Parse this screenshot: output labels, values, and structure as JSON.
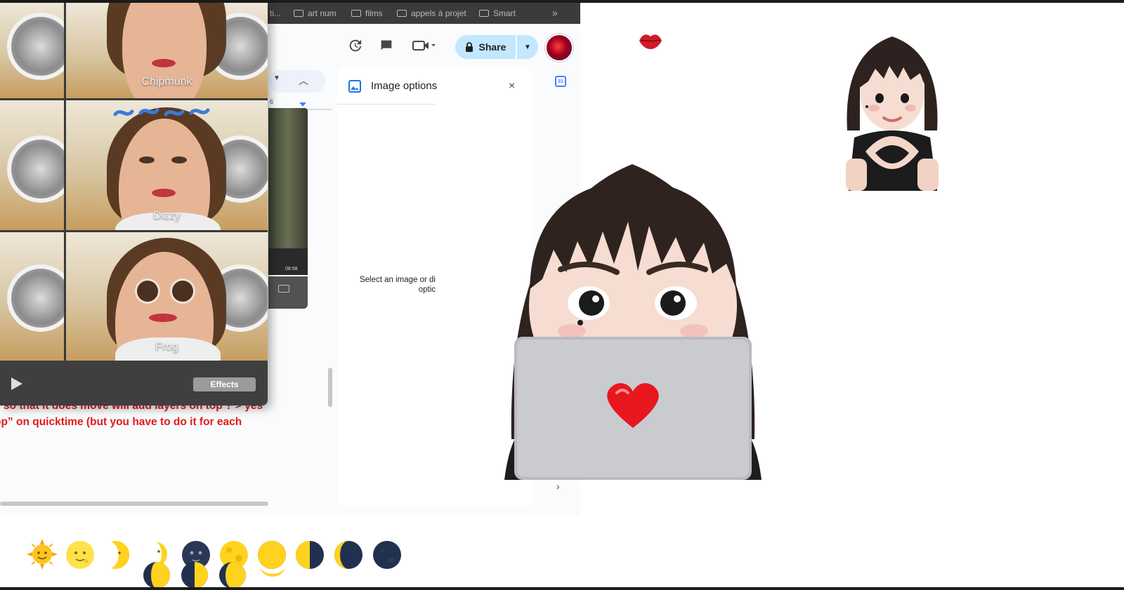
{
  "bookmarks": [
    {
      "label": "ti..."
    },
    {
      "label": "art num"
    },
    {
      "label": "films"
    },
    {
      "label": "appels à projet"
    },
    {
      "label": "Smart"
    }
  ],
  "bookmarks_more": "»",
  "toolbar": {
    "share_label": "Share",
    "share_icon": "lock-icon",
    "history_icon": "history-icon",
    "comment_icon": "comment-icon",
    "meet_icon": "video-icon"
  },
  "ruler": {
    "mark": "6"
  },
  "side_panel": {
    "title": "Image options",
    "message_line1": "Select an image or di",
    "message_line2": "optic",
    "close": "×",
    "next": "›"
  },
  "calendar_icon_text": "31",
  "doc_text": {
    "line1": "e so that it does move will add layers on top ? > yes",
    "line2": "op” on quicktime (but you have to do it for each"
  },
  "photo_booth": {
    "effects": [
      {
        "label": "Chipmunk"
      },
      {
        "label": "Dizzy"
      },
      {
        "label": "Frog"
      }
    ],
    "effects_button": "Effects",
    "timestamp": "08:58"
  },
  "moon_phases": [
    "sun-with-face",
    "full-moon-face",
    "crescent-moon-face",
    "first-quarter-moon-face",
    "new-moon-face",
    "full-moon",
    "waning-gibbous-moon",
    "last-quarter-moon",
    "waning-crescent-moon",
    "new-moon"
  ],
  "colors": {
    "accent_red": "#e31b1b",
    "share_bg": "#c2e7ff",
    "bookmark_bar": "#3b3b3d",
    "photobooth_bg": "#3a3a3a"
  }
}
